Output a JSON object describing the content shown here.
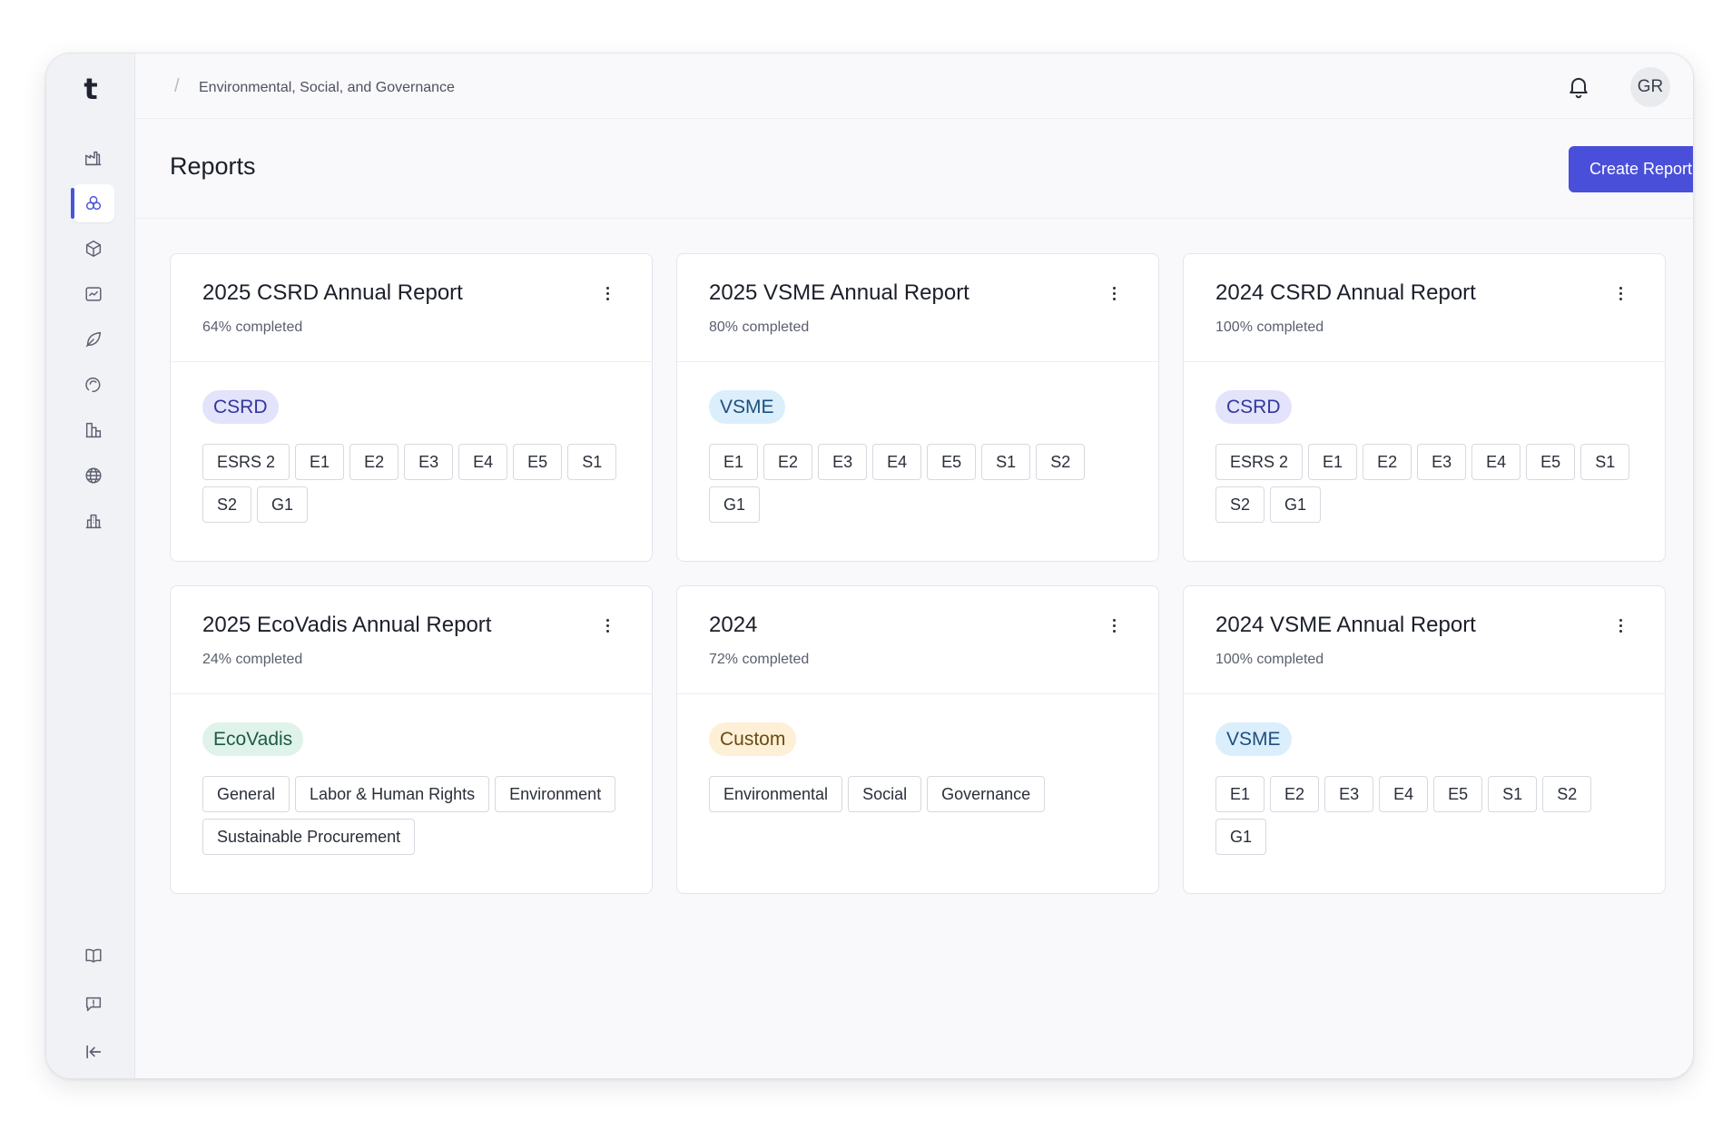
{
  "app": {
    "logo_text": "t",
    "breadcrumb": "Environmental, Social, and Governance",
    "avatar_initials": "GR"
  },
  "sidebar": {
    "items": [
      {
        "icon": "factory-icon",
        "active": false
      },
      {
        "icon": "esg-circles-icon",
        "active": true
      },
      {
        "icon": "cube-icon",
        "active": false
      },
      {
        "icon": "chart-image-icon",
        "active": false
      },
      {
        "icon": "leaf-icon",
        "active": false
      },
      {
        "icon": "cycle-icon",
        "active": false
      },
      {
        "icon": "buildings-icon",
        "active": false
      },
      {
        "icon": "globe-icon",
        "active": false
      },
      {
        "icon": "office-building-icon",
        "active": false
      }
    ],
    "bottom_items": [
      {
        "icon": "book-icon"
      },
      {
        "icon": "feedback-icon"
      },
      {
        "icon": "collapse-sidebar-icon"
      }
    ]
  },
  "header": {
    "title": "Reports",
    "create_label": "Create Report"
  },
  "colors": {
    "accent": "#4a4fd9",
    "pill_csrd": "#e3e3fb",
    "pill_vsme": "#dbeefb",
    "pill_ecovadis": "#dff3ea",
    "pill_custom": "#fdf0d7"
  },
  "reports": [
    {
      "title": "2025 CSRD Annual Report",
      "progress": "64% completed",
      "framework": "CSRD",
      "tags": [
        "ESRS 2",
        "E1",
        "E2",
        "E3",
        "E4",
        "E5",
        "S1",
        "S2",
        "G1"
      ]
    },
    {
      "title": "2025 VSME Annual Report",
      "progress": "80% completed",
      "framework": "VSME",
      "tags": [
        "E1",
        "E2",
        "E3",
        "E4",
        "E5",
        "S1",
        "S2",
        "G1"
      ]
    },
    {
      "title": "2024 CSRD Annual Report",
      "progress": "100% completed",
      "framework": "CSRD",
      "tags": [
        "ESRS 2",
        "E1",
        "E2",
        "E3",
        "E4",
        "E5",
        "S1",
        "S2",
        "G1"
      ]
    },
    {
      "title": "2025 EcoVadis Annual Report",
      "progress": "24% completed",
      "framework": "EcoVadis",
      "tags": [
        "General",
        "Labor & Human Rights",
        "Environment",
        "Sustainable Procurement"
      ]
    },
    {
      "title": "2024",
      "progress": "72% completed",
      "framework": "Custom",
      "tags": [
        "Environmental",
        "Social",
        "Governance"
      ]
    },
    {
      "title": "2024 VSME Annual Report",
      "progress": "100% completed",
      "framework": "VSME",
      "tags": [
        "E1",
        "E2",
        "E3",
        "E4",
        "E5",
        "S1",
        "S2",
        "G1"
      ]
    }
  ]
}
